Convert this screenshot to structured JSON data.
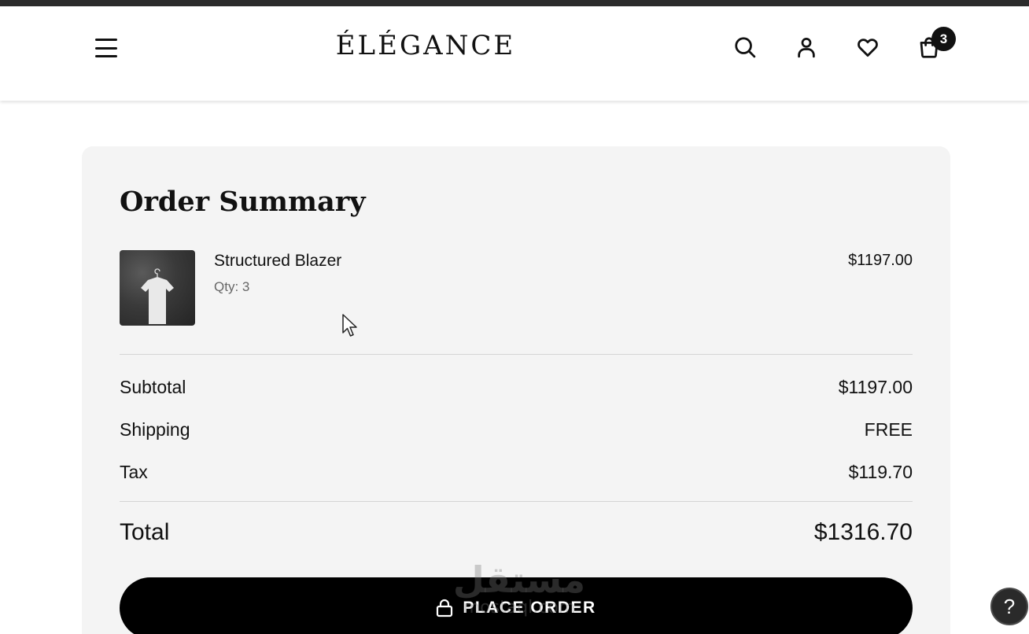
{
  "header": {
    "brand": "ÉLÉGANCE",
    "icons": [
      "menu-icon",
      "search-icon",
      "user-icon",
      "heart-icon",
      "shopping-bag-icon"
    ],
    "cart_count": "3"
  },
  "summary": {
    "title": "Order Summary",
    "item": {
      "name": "Structured Blazer",
      "qty_label": "Qty:",
      "qty": "3",
      "price": "$1197.00"
    },
    "rows": [
      {
        "label": "Subtotal",
        "value": "$1197.00"
      },
      {
        "label": "Shipping",
        "value": "FREE"
      },
      {
        "label": "Tax",
        "value": "$119.70"
      }
    ],
    "total": {
      "label": "Total",
      "value": "$1316.70"
    },
    "place_order_label": "PLACE ORDER"
  },
  "help": {
    "label": "?"
  },
  "watermark": {
    "arabic": "مستقل",
    "latin": "mostaql.com"
  },
  "colors": {
    "accent": "#000000",
    "card_bg": "#f4f4f4",
    "top_strip": "#2b2b2b"
  }
}
